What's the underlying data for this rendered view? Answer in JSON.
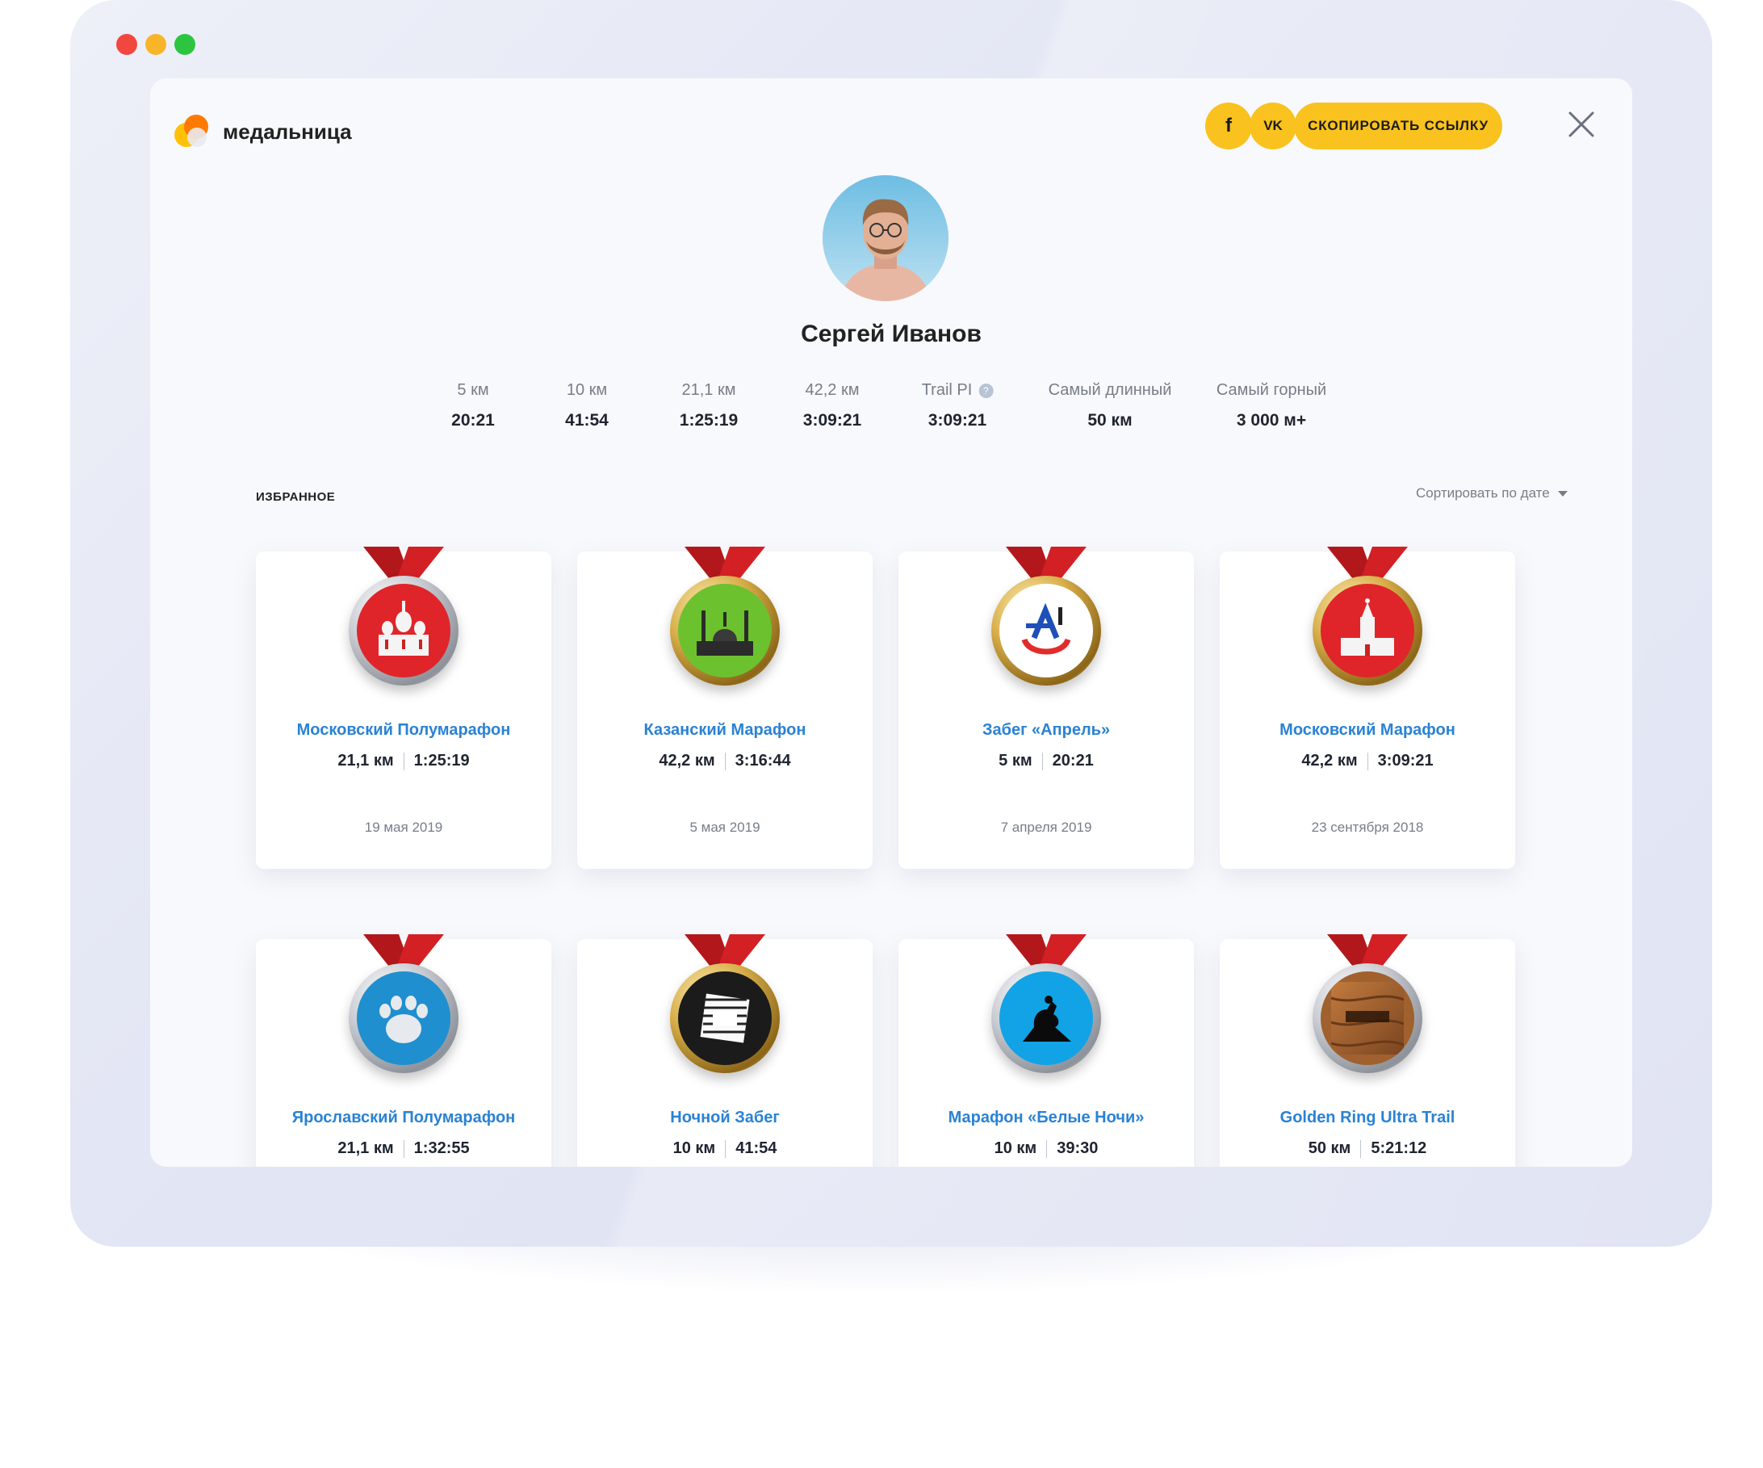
{
  "brand": {
    "name": "медальница"
  },
  "header": {
    "facebook_label": "f",
    "vk_label": "VK",
    "copy_link_label": "СКОПИРОВАТЬ ССЫЛКУ"
  },
  "profile": {
    "name": "Сергей Иванов",
    "stats": [
      {
        "label": "5 км",
        "value": "20:21"
      },
      {
        "label": "10 км",
        "value": "41:54"
      },
      {
        "label": "21,1 км",
        "value": "1:25:19"
      },
      {
        "label": "42,2 км",
        "value": "3:09:21"
      },
      {
        "label": "Trail PI",
        "value": "3:09:21",
        "help": "?"
      },
      {
        "label": "Самый длинный",
        "value": "50 км"
      },
      {
        "label": "Самый горный",
        "value": "3 000 м+"
      }
    ]
  },
  "favorites": {
    "section_title": "ИЗБРАННОЕ",
    "sort_label": "Сортировать по дате",
    "cards": [
      {
        "title": "Московский Полумарафон",
        "distance": "21,1 км",
        "time": "1:25:19",
        "date": "19 мая 2019",
        "medal": "silver",
        "medal_color": "#e0252a",
        "emblem": "cathedral-icon"
      },
      {
        "title": "Казанский Марафон",
        "distance": "42,2 км",
        "time": "3:16:44",
        "date": "5 мая 2019",
        "medal": "gold",
        "medal_color": "#6cc12f",
        "emblem": "mosque-icon"
      },
      {
        "title": "Забег «Апрель»",
        "distance": "5 км",
        "time": "20:21",
        "date": "7 апреля 2019",
        "medal": "gold",
        "medal_color": "#ffffff",
        "emblem": "april-logo-icon"
      },
      {
        "title": "Московский Марафон",
        "distance": "42,2 км",
        "time": "3:09:21",
        "date": "23 сентября 2018",
        "medal": "gold",
        "medal_color": "#e0252a",
        "emblem": "kremlin-icon"
      },
      {
        "title": "Ярославский Полумарафон",
        "distance": "21,1 км",
        "time": "1:32:55",
        "date": "",
        "medal": "silver",
        "medal_color": "#1f8fcf",
        "emblem": "bear-paw-icon"
      },
      {
        "title": "Ночной Забег",
        "distance": "10 км",
        "time": "41:54",
        "date": "",
        "medal": "gold",
        "medal_color": "#1b1b1b",
        "emblem": "night-run-logo-icon"
      },
      {
        "title": "Марафон «Белые Ночи»",
        "distance": "10 км",
        "time": "39:30",
        "date": "",
        "medal": "silver",
        "medal_color": "#11a3e6",
        "emblem": "bronze-horseman-icon"
      },
      {
        "title": "Golden Ring Ultra Trail",
        "distance": "50 км",
        "time": "5:21:12",
        "date": "",
        "medal": "silver",
        "medal_color": "#a0612e",
        "emblem": "golden-ring-logo-icon"
      }
    ]
  }
}
